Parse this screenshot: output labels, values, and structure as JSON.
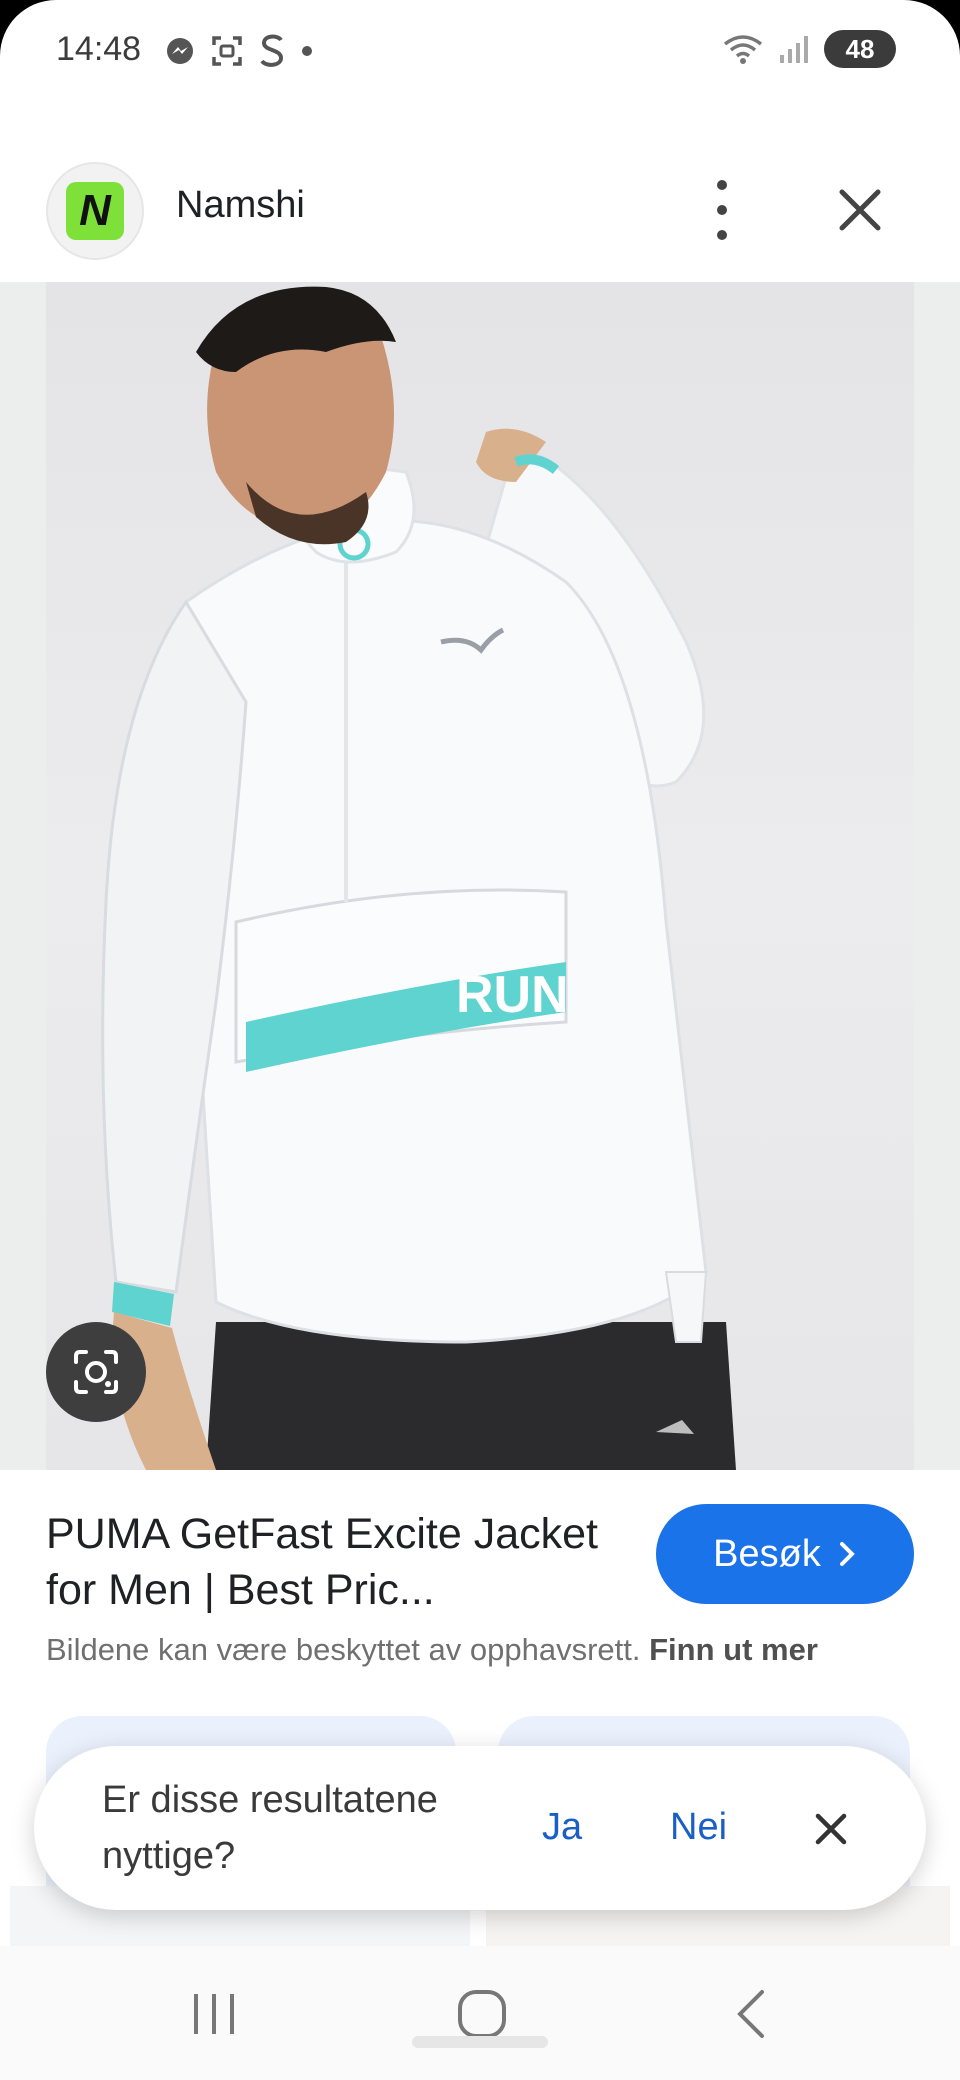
{
  "status_bar": {
    "time": "14:48",
    "battery": "48",
    "icons": [
      "messenger-icon",
      "screenshot-icon",
      "s-icon",
      "dot-icon",
      "wifi-icon",
      "signal-icon"
    ]
  },
  "header": {
    "logo_letter": "N",
    "site_name": "Namshi"
  },
  "result": {
    "title": "PUMA GetFast Excite Jacket for Men | Best Pric...",
    "visit_label": "Besøk",
    "copyright_text": "Bildene kan være beskyttet av opphavsrett.",
    "learn_more": "Finn ut mer"
  },
  "photo": {
    "chest_text": "RUN"
  },
  "feedback": {
    "question": "Er disse resultatene nyttige?",
    "yes": "Ja",
    "no": "Nei"
  },
  "colors": {
    "accent": "#1a73e8",
    "logo_green": "#7ee13a",
    "teal": "#5fd3cf"
  }
}
